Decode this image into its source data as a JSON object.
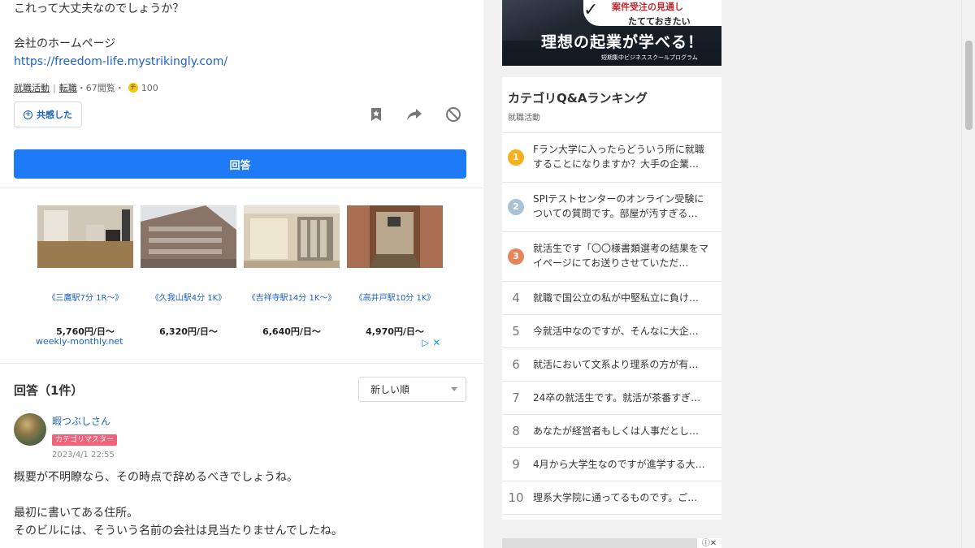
{
  "question": {
    "text_line": "これって大丈夫なのでしょうか？",
    "homepage_label": "会社のホームページ",
    "homepage_url": "https://freedom-life.mystrikingly.com/",
    "category1": "就職活動",
    "category2": "転職",
    "views": "・67閲覧・",
    "coins": "100",
    "empathy_label": "共感した",
    "answer_button": "回答"
  },
  "ad": {
    "items": [
      {
        "title": "《三鷹駅7分 1R～》",
        "price": "5,760円/日～"
      },
      {
        "title": "《久我山駅4分 1K》",
        "price": "6,320円/日～"
      },
      {
        "title": "《吉祥寺駅14分 1K～》",
        "price": "6,640円/日～"
      },
      {
        "title": "《高井戸駅10分 1K》",
        "price": "4,970円/日～"
      }
    ],
    "domain": "weekly-monthly.net",
    "choices": "▷ ✕"
  },
  "answers": {
    "heading": "回答（1件）",
    "sort_label": "新しい順",
    "user_name": "暇つぶしさん",
    "badge": "カテゴリマスター",
    "date": "2023/4/1 22:55",
    "body": [
      "概要が不明瞭なら、その時点で辞めるべきでしょうね。",
      "",
      "最初に書いてある住所。",
      "そのビルには、そういう名前の会社は見当たりませんでしたね。"
    ]
  },
  "banner": {
    "line1": "案件受注の見通し",
    "line2": "たてておきたい",
    "headline": "理想の起業が学べる！",
    "sub": "短期集中ビジネススクールプログラム"
  },
  "ranking": {
    "title": "カテゴリQ&Aランキング",
    "subtitle": "就職活動",
    "medal_colors": [
      "#f6b01e",
      "#a9c2d6",
      "#e8845a"
    ],
    "items": [
      {
        "num": "1",
        "text": "Fラン大学に入ったらどういう所に就職することになりますか？大手の企業…"
      },
      {
        "num": "2",
        "text": "SPIテストセンターのオンライン受験についての質問です。部屋が汚すぎる…"
      },
      {
        "num": "3",
        "text": "就活生です「〇〇様書類選考の結果をマイページにてお送りさせていただ…"
      },
      {
        "num": "4",
        "text": "就職で国公立の私が中堅私立に負け…"
      },
      {
        "num": "5",
        "text": "今就活中なのですが、そんなに大企…"
      },
      {
        "num": "6",
        "text": "就活において文系より理系の方が有…"
      },
      {
        "num": "7",
        "text": "24卒の就活生です。就活が茶番すぎ…"
      },
      {
        "num": "8",
        "text": "あなたが経営者もしくは人事だとし…"
      },
      {
        "num": "9",
        "text": "4月から大学生なのですが進学する大…"
      },
      {
        "num": "10",
        "text": "理系大学院に通ってるものです。ご…"
      }
    ]
  },
  "bottom_ad": {
    "controls": "ⓘ✕"
  }
}
